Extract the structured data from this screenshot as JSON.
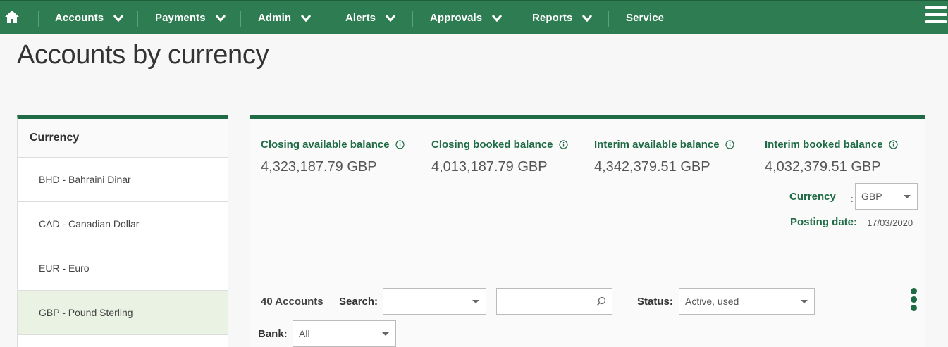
{
  "nav": {
    "items": [
      {
        "label": "Accounts"
      },
      {
        "label": "Payments"
      },
      {
        "label": "Admin"
      },
      {
        "label": "Alerts"
      },
      {
        "label": "Approvals"
      },
      {
        "label": "Reports"
      },
      {
        "label": "Service"
      }
    ]
  },
  "page": {
    "title": "Accounts by currency"
  },
  "currency_list": {
    "header": "Currency",
    "items": [
      {
        "label": "BHD - Bahraini Dinar"
      },
      {
        "label": "CAD - Canadian Dollar"
      },
      {
        "label": "EUR - Euro"
      },
      {
        "label": "GBP - Pound Sterling",
        "selected": true
      }
    ]
  },
  "balances": [
    {
      "label": "Closing available balance",
      "value": "4,323,187.79 GBP"
    },
    {
      "label": "Closing booked balance",
      "value": "4,013,187.79 GBP"
    },
    {
      "label": "Interim available balance",
      "value": "4,342,379.51 GBP"
    },
    {
      "label": "Interim booked balance",
      "value": "4,032,379.51 GBP"
    }
  ],
  "currency_select": {
    "label": "Currency",
    "colon": ":",
    "value": "GBP"
  },
  "posting": {
    "label": "Posting date:",
    "value": "17/03/2020"
  },
  "filters": {
    "count": "40 Accounts",
    "search_label": "Search:",
    "search_field_value": "",
    "search_text": "",
    "status_label": "Status:",
    "status_value": "Active, used",
    "bank_label": "Bank:",
    "bank_value": "All"
  },
  "colors": {
    "nav_bg": "#2e7d52",
    "accent": "#1e6b45",
    "selected_row": "#eaf2e3"
  }
}
